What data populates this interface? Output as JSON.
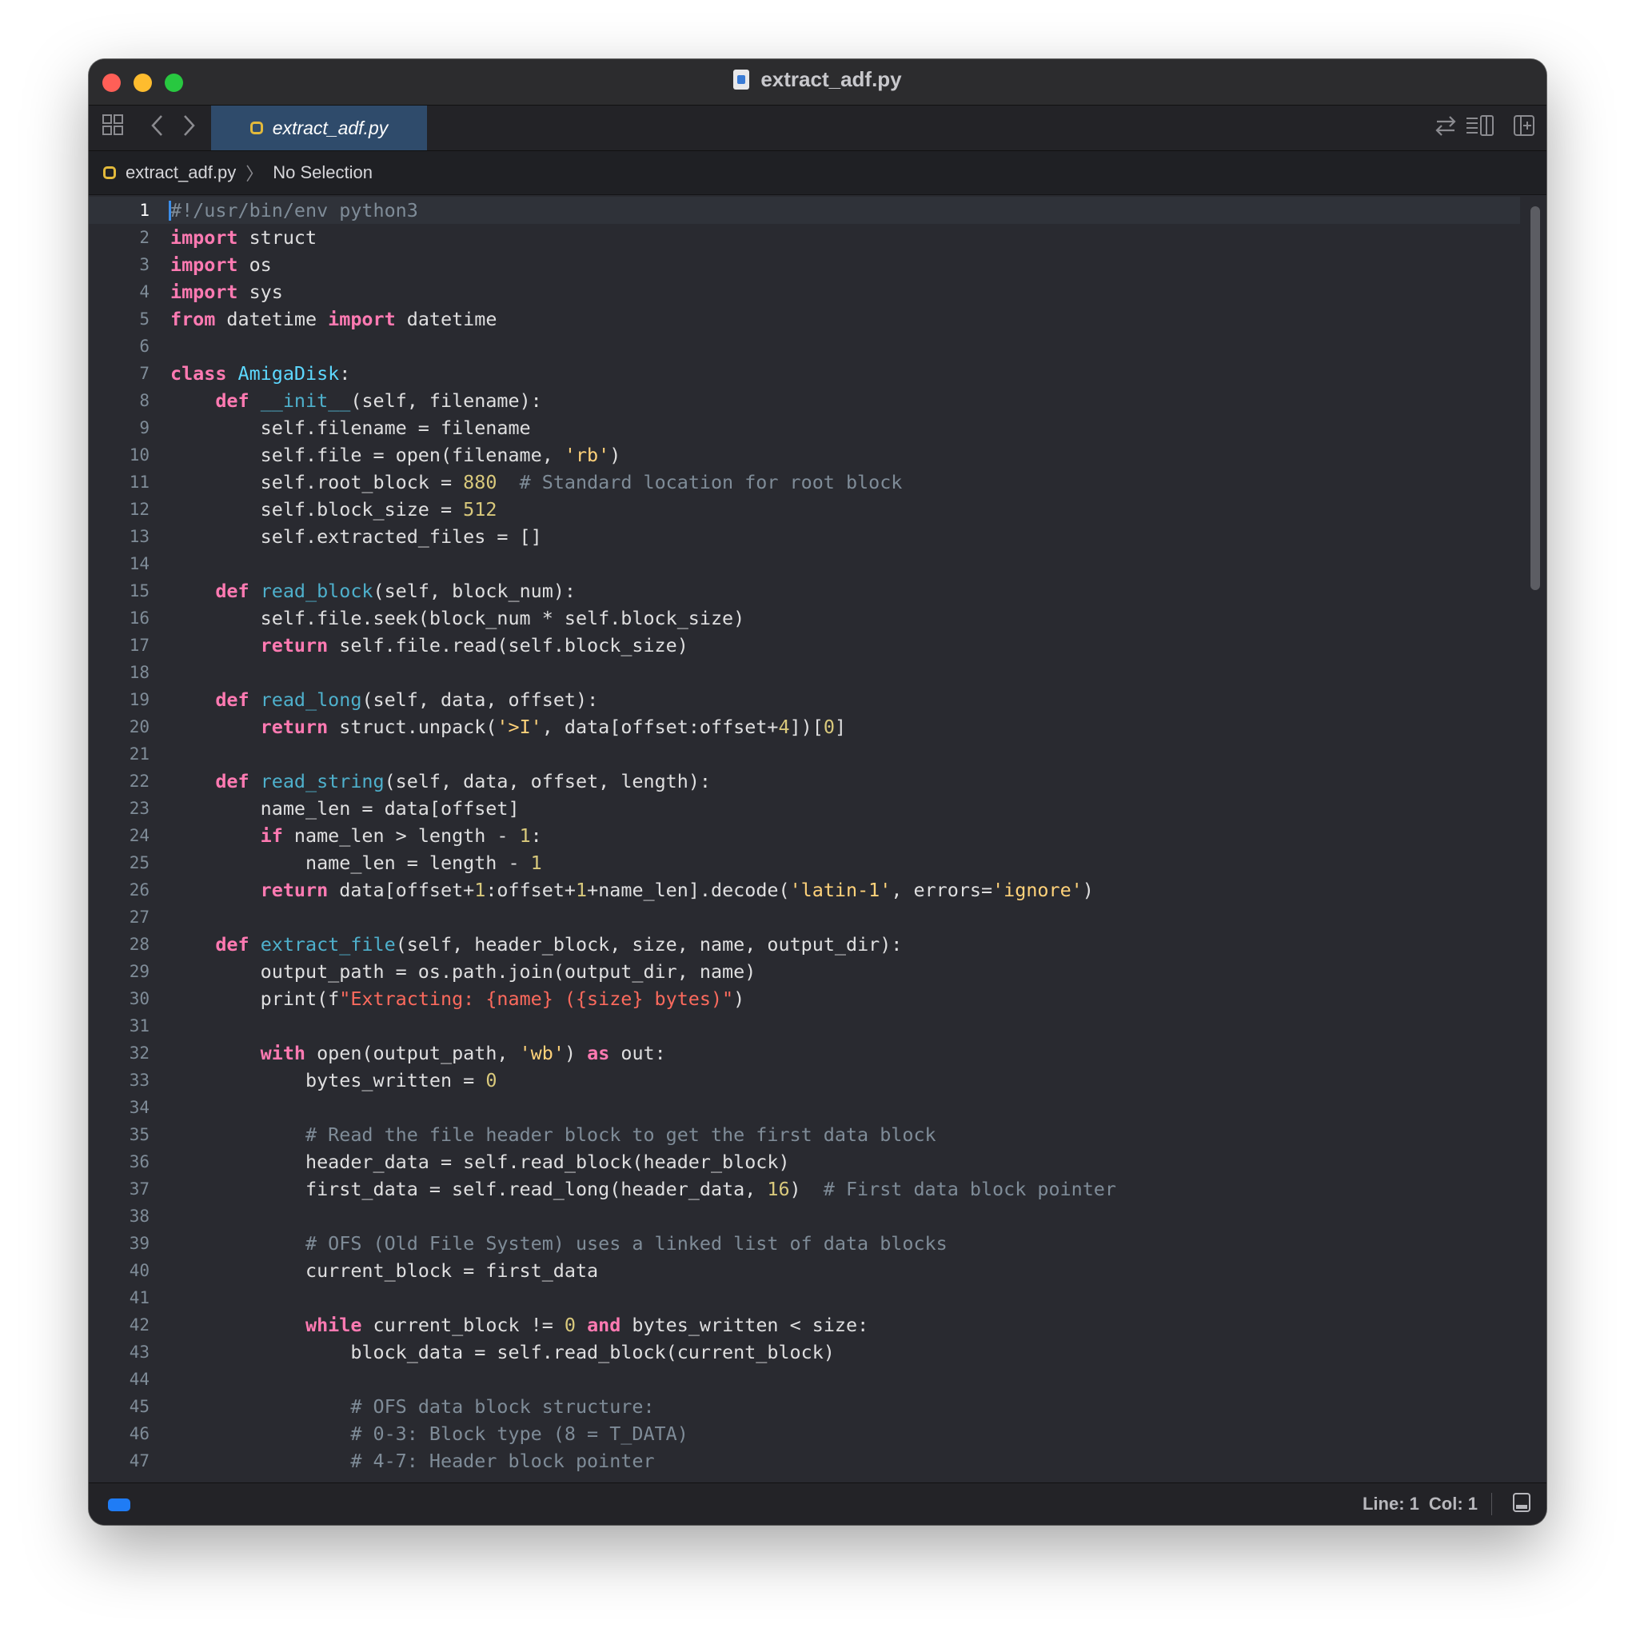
{
  "window": {
    "title": "extract_adf.py"
  },
  "tab": {
    "label": "extract_adf.py"
  },
  "breadcrumb": {
    "file": "extract_adf.py",
    "selection": "No Selection"
  },
  "status": {
    "line_label": "Line: 1",
    "col_label": "Col: 1"
  },
  "editor": {
    "current_line": 1,
    "lines": [
      [
        [
          "cm",
          "#!/usr/bin/env python3"
        ]
      ],
      [
        [
          "kw",
          "import"
        ],
        [
          "p",
          " struct"
        ]
      ],
      [
        [
          "kw",
          "import"
        ],
        [
          "p",
          " os"
        ]
      ],
      [
        [
          "kw",
          "import"
        ],
        [
          "p",
          " sys"
        ]
      ],
      [
        [
          "kw",
          "from"
        ],
        [
          "p",
          " datetime "
        ],
        [
          "kw",
          "import"
        ],
        [
          "p",
          " datetime"
        ]
      ],
      [],
      [
        [
          "kw",
          "class"
        ],
        [
          "p",
          " "
        ],
        [
          "cls",
          "AmigaDisk"
        ],
        [
          "p",
          ":"
        ]
      ],
      [
        [
          "p",
          "    "
        ],
        [
          "kw",
          "def"
        ],
        [
          "p",
          " "
        ],
        [
          "fn",
          "__init__"
        ],
        [
          "p",
          "(self, filename):"
        ]
      ],
      [
        [
          "p",
          "        self.filename = filename"
        ]
      ],
      [
        [
          "p",
          "        self.file = open(filename, "
        ],
        [
          "str",
          "'rb'"
        ],
        [
          "p",
          ")"
        ]
      ],
      [
        [
          "p",
          "        self.root_block = "
        ],
        [
          "num",
          "880"
        ],
        [
          "p",
          "  "
        ],
        [
          "cm",
          "# Standard location for root block"
        ]
      ],
      [
        [
          "p",
          "        self.block_size = "
        ],
        [
          "num",
          "512"
        ]
      ],
      [
        [
          "p",
          "        self.extracted_files = []"
        ]
      ],
      [],
      [
        [
          "p",
          "    "
        ],
        [
          "kw",
          "def"
        ],
        [
          "p",
          " "
        ],
        [
          "fn",
          "read_block"
        ],
        [
          "p",
          "(self, block_num):"
        ]
      ],
      [
        [
          "p",
          "        self.file.seek(block_num * self.block_size)"
        ]
      ],
      [
        [
          "p",
          "        "
        ],
        [
          "kw",
          "return"
        ],
        [
          "p",
          " self.file.read(self.block_size)"
        ]
      ],
      [],
      [
        [
          "p",
          "    "
        ],
        [
          "kw",
          "def"
        ],
        [
          "p",
          " "
        ],
        [
          "fn",
          "read_long"
        ],
        [
          "p",
          "(self, data, offset):"
        ]
      ],
      [
        [
          "p",
          "        "
        ],
        [
          "kw",
          "return"
        ],
        [
          "p",
          " struct.unpack("
        ],
        [
          "str",
          "'>I'"
        ],
        [
          "p",
          ", data[offset:offset+"
        ],
        [
          "num",
          "4"
        ],
        [
          "p",
          "])["
        ],
        [
          "num",
          "0"
        ],
        [
          "p",
          "]"
        ]
      ],
      [],
      [
        [
          "p",
          "    "
        ],
        [
          "kw",
          "def"
        ],
        [
          "p",
          " "
        ],
        [
          "fn",
          "read_string"
        ],
        [
          "p",
          "(self, data, offset, length):"
        ]
      ],
      [
        [
          "p",
          "        name_len = data[offset]"
        ]
      ],
      [
        [
          "p",
          "        "
        ],
        [
          "kw",
          "if"
        ],
        [
          "p",
          " name_len > length - "
        ],
        [
          "num",
          "1"
        ],
        [
          "p",
          ":"
        ]
      ],
      [
        [
          "p",
          "            name_len = length - "
        ],
        [
          "num",
          "1"
        ]
      ],
      [
        [
          "p",
          "        "
        ],
        [
          "kw",
          "return"
        ],
        [
          "p",
          " data[offset+"
        ],
        [
          "num",
          "1"
        ],
        [
          "p",
          ":offset+"
        ],
        [
          "num",
          "1"
        ],
        [
          "p",
          "+name_len].decode("
        ],
        [
          "str",
          "'latin-1'"
        ],
        [
          "p",
          ", errors="
        ],
        [
          "str",
          "'ignore'"
        ],
        [
          "p",
          ")"
        ]
      ],
      [],
      [
        [
          "p",
          "    "
        ],
        [
          "kw",
          "def"
        ],
        [
          "p",
          " "
        ],
        [
          "fn",
          "extract_file"
        ],
        [
          "p",
          "(self, header_block, size, name, output_dir):"
        ]
      ],
      [
        [
          "p",
          "        output_path = os.path.join(output_dir, name)"
        ]
      ],
      [
        [
          "p",
          "        print(f"
        ],
        [
          "fstr",
          "\"Extracting: {name} ({size} bytes)\""
        ],
        [
          "p",
          ")"
        ]
      ],
      [],
      [
        [
          "p",
          "        "
        ],
        [
          "kw",
          "with"
        ],
        [
          "p",
          " open(output_path, "
        ],
        [
          "str",
          "'wb'"
        ],
        [
          "p",
          ") "
        ],
        [
          "kw",
          "as"
        ],
        [
          "p",
          " out:"
        ]
      ],
      [
        [
          "p",
          "            bytes_written = "
        ],
        [
          "num",
          "0"
        ]
      ],
      [],
      [
        [
          "p",
          "            "
        ],
        [
          "cm",
          "# Read the file header block to get the first data block"
        ]
      ],
      [
        [
          "p",
          "            header_data = self.read_block(header_block)"
        ]
      ],
      [
        [
          "p",
          "            first_data = self.read_long(header_data, "
        ],
        [
          "num",
          "16"
        ],
        [
          "p",
          ")  "
        ],
        [
          "cm",
          "# First data block pointer"
        ]
      ],
      [],
      [
        [
          "p",
          "            "
        ],
        [
          "cm",
          "# OFS (Old File System) uses a linked list of data blocks"
        ]
      ],
      [
        [
          "p",
          "            current_block = first_data"
        ]
      ],
      [],
      [
        [
          "p",
          "            "
        ],
        [
          "kw",
          "while"
        ],
        [
          "p",
          " current_block != "
        ],
        [
          "num",
          "0"
        ],
        [
          "p",
          " "
        ],
        [
          "kw",
          "and"
        ],
        [
          "p",
          " bytes_written < size:"
        ]
      ],
      [
        [
          "p",
          "                block_data = self.read_block(current_block)"
        ]
      ],
      [],
      [
        [
          "p",
          "                "
        ],
        [
          "cm",
          "# OFS data block structure:"
        ]
      ],
      [
        [
          "p",
          "                "
        ],
        [
          "cm",
          "# 0-3: Block type (8 = T_DATA)"
        ]
      ],
      [
        [
          "p",
          "                "
        ],
        [
          "cm",
          "# 4-7: Header block pointer"
        ]
      ]
    ]
  },
  "icons": {
    "grid": "grid-icon",
    "back": "chevron-left-icon",
    "forward": "chevron-right-icon",
    "swap": "swap-arrows-icon",
    "inspector": "inspector-icon",
    "add_editor": "add-editor-icon",
    "python": "python-file-icon",
    "panel": "bottom-panel-icon"
  }
}
